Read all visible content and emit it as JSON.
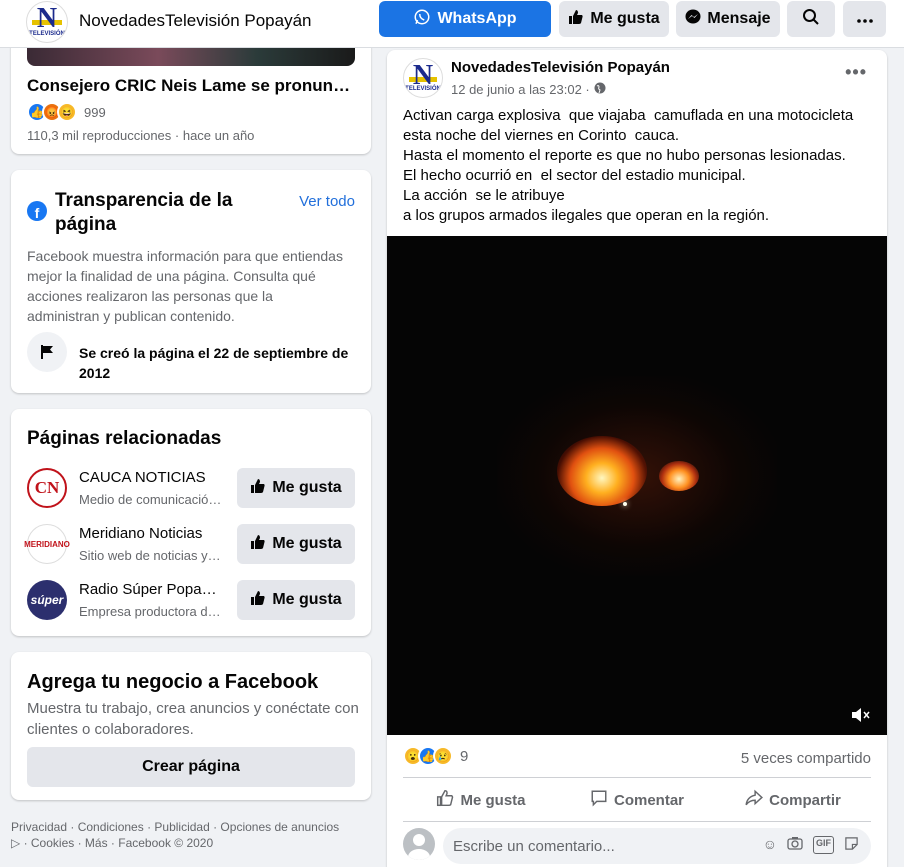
{
  "header": {
    "page_name": "NovedadesTelevisión Popayán",
    "whatsapp_label": "WhatsApp",
    "like_label": "Me gusta",
    "message_label": "Mensaje",
    "logo": {
      "letter": "N",
      "sub": "TELEVISIÓN"
    }
  },
  "left": {
    "video": {
      "title": "Consejero CRIC Neis Lame se pronunció sobre la situación",
      "reactions_count": "999",
      "meta": "110,3 mil reproducciones · hace un año"
    },
    "transparency": {
      "title": "Transparencia de la página",
      "see_all": "Ver todo",
      "description": "Facebook muestra información para que entiendas mejor la finalidad de una página. Consulta qué acciones realizaron las personas que la administran y publican contenido.",
      "created": "Se creó la página el 22 de septiembre de 2012"
    },
    "related": {
      "title": "Páginas relacionadas",
      "like_label": "Me gusta",
      "items": [
        {
          "name": "CAUCA NOTICIAS",
          "sub": "Medio de comunicación/noticias",
          "avatar_text": "CN"
        },
        {
          "name": "Meridiano Noticias",
          "sub": "Sitio web de noticias y medios",
          "avatar_text": "MERIDIANO"
        },
        {
          "name": "Radio Súper Popayán",
          "sub": "Empresa productora de radio",
          "avatar_text": "súper"
        }
      ]
    },
    "business": {
      "title": "Agrega tu negocio a Facebook",
      "description": "Muestra tu trabajo, crea anuncios y conéctate con clientes o colaboradores.",
      "button": "Crear página"
    },
    "footer": {
      "line1": "Privacidad · Condiciones · Publicidad · Opciones de anuncios",
      "line2": "▷ · Cookies · Más · Facebook © 2020"
    }
  },
  "post": {
    "author": "NovedadesTelevisión Popayán",
    "time": "12 de junio a las 23:02 ·",
    "lines": [
      "Activan carga explosiva  que viajaba  camuflada en una motocicleta",
      "esta noche del viernes en Corinto  cauca.",
      "Hasta el momento el reporte es que no hubo personas lesionadas.",
      "El hecho ocurrió en  el sector del estadio municipal.",
      "La acción  se le atribuye",
      "a los grupos armados ilegales que operan en la región."
    ],
    "reactions_count": "9",
    "shares": "5 veces compartido",
    "actions": {
      "like": "Me gusta",
      "comment": "Comentar",
      "share": "Compartir"
    },
    "comment_placeholder": "Escribe un comentario..."
  },
  "colors": {
    "accent": "#1b74e4",
    "link": "#216fdb",
    "secondary_text": "#65676b",
    "button_gray": "#e4e6eb"
  }
}
